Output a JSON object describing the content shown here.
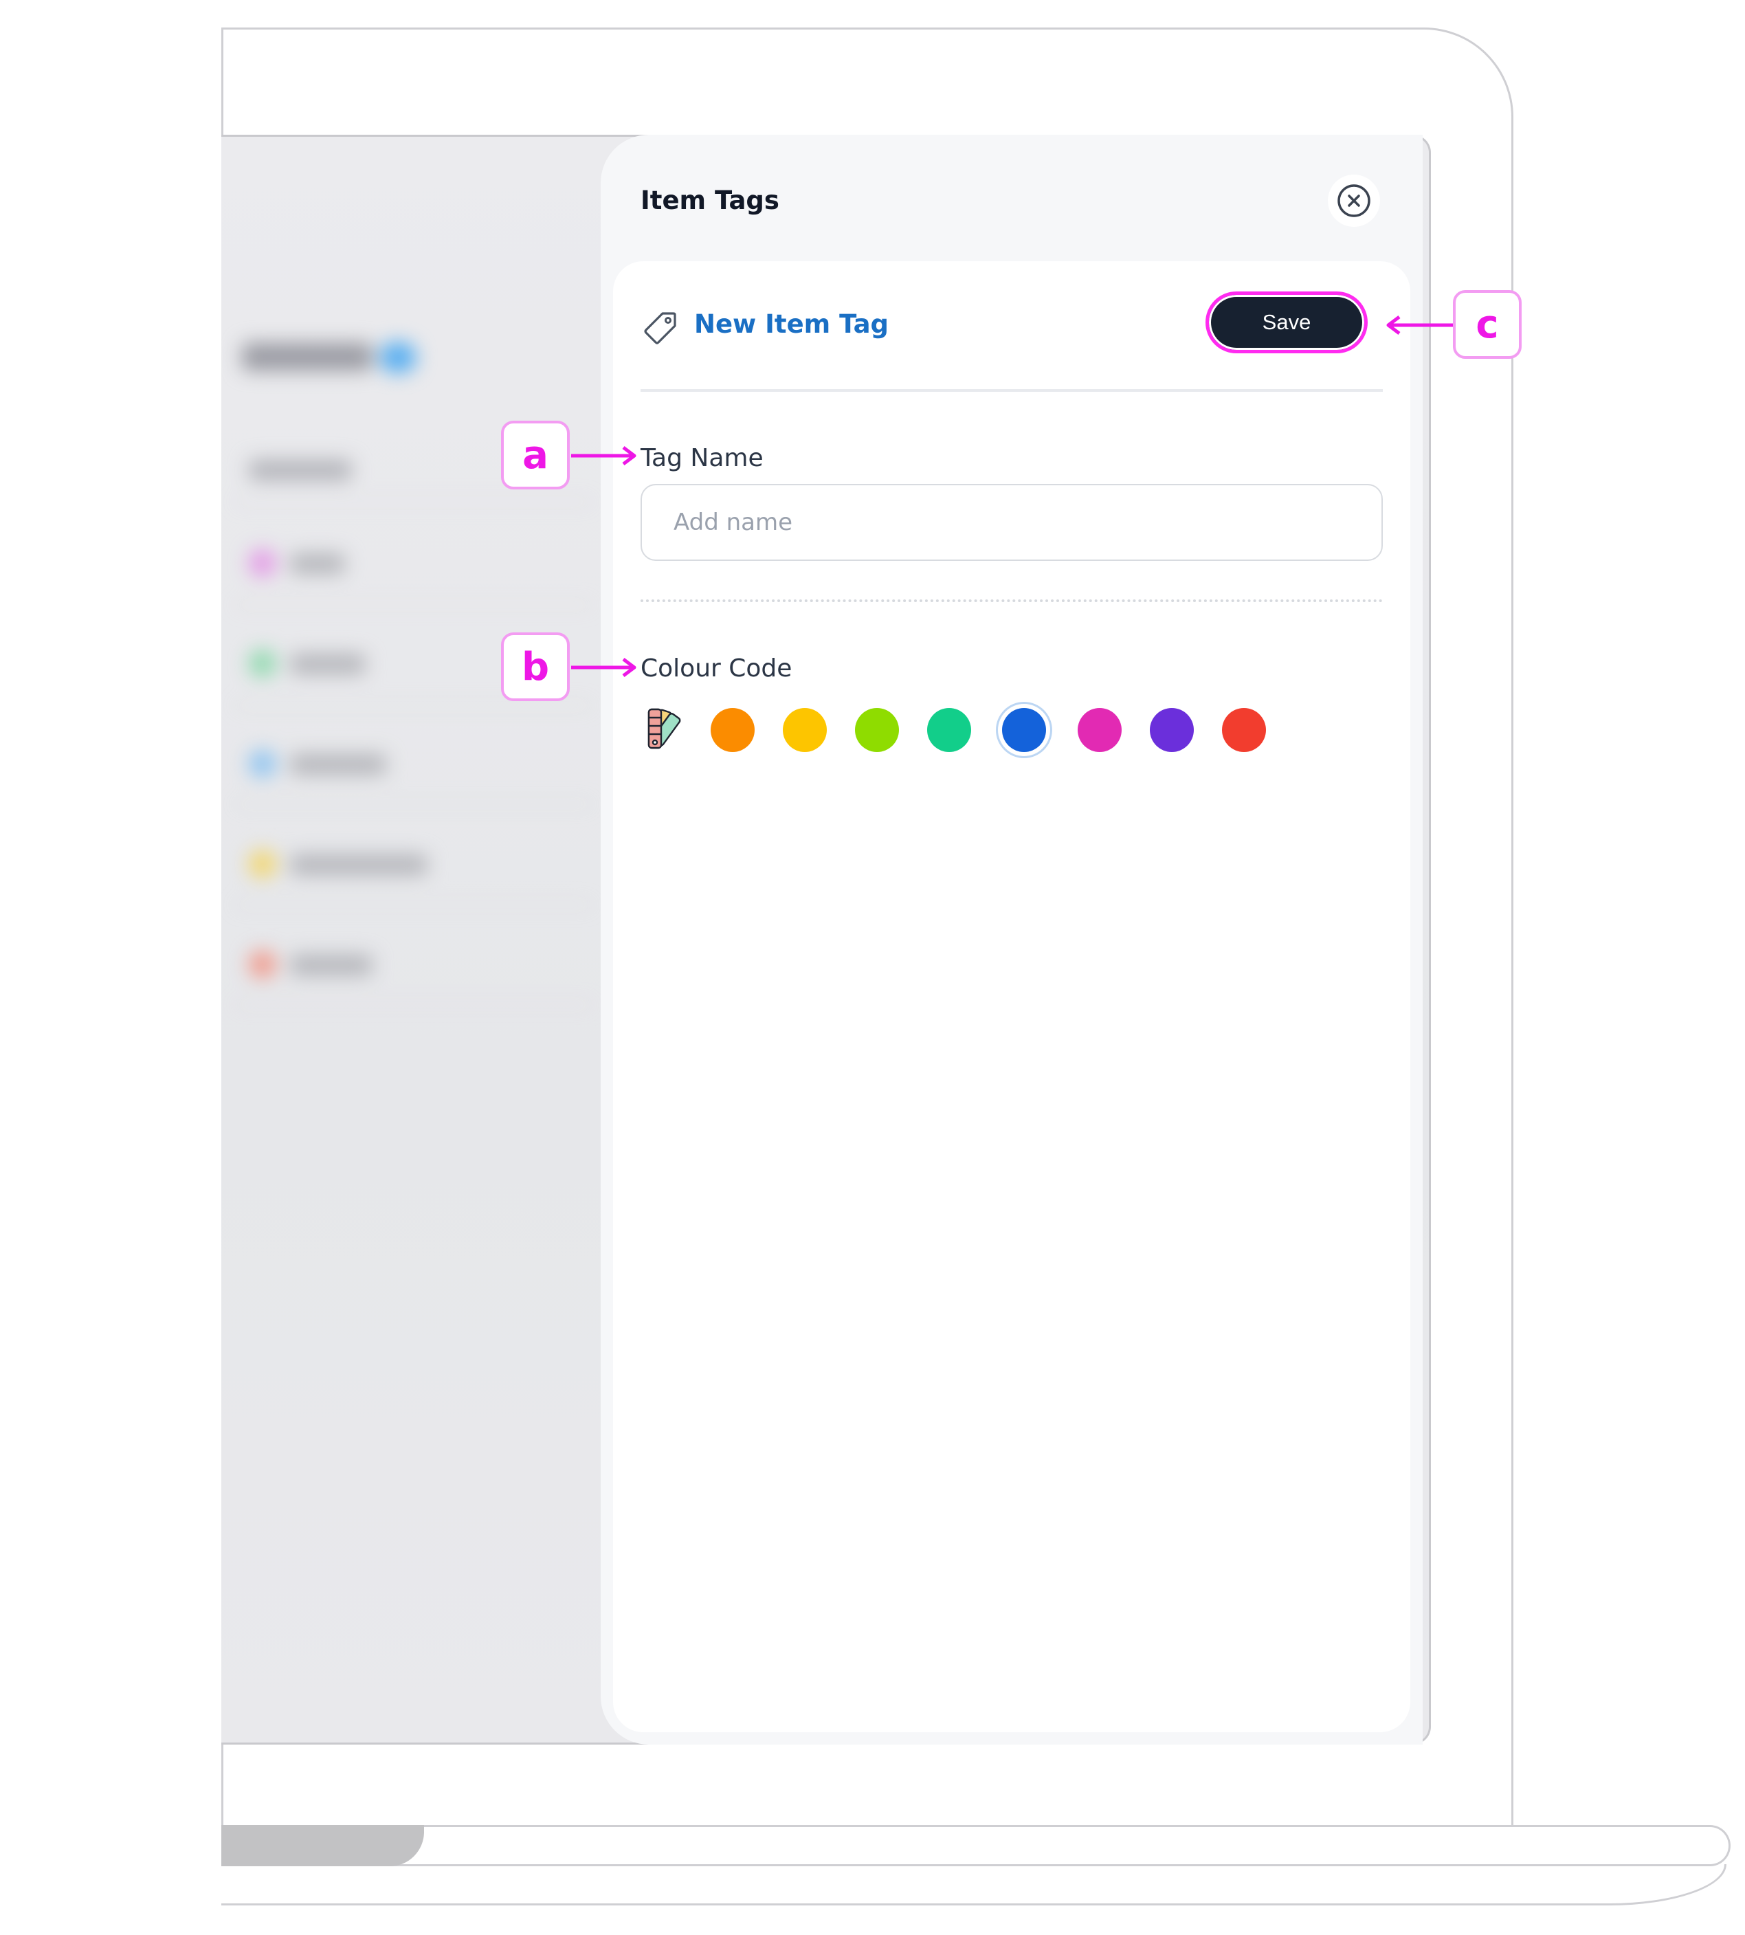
{
  "panel": {
    "title": "Item Tags",
    "close_icon": "close-circle-icon"
  },
  "form": {
    "header_icon": "tag-icon",
    "header_title": "New Item Tag",
    "save_label": "Save",
    "tag_name_label": "Tag Name",
    "tag_name_placeholder": "Add name",
    "tag_name_value": "",
    "colour_label": "Colour Code",
    "palette_icon": "color-palette-icon",
    "colours": [
      {
        "name": "orange",
        "hex": "#FB8C00",
        "selected": false
      },
      {
        "name": "amber",
        "hex": "#FDC500",
        "selected": false
      },
      {
        "name": "lime",
        "hex": "#8FDC00",
        "selected": false
      },
      {
        "name": "green",
        "hex": "#12CE8A",
        "selected": false
      },
      {
        "name": "blue",
        "hex": "#1462DA",
        "selected": true
      },
      {
        "name": "magenta",
        "hex": "#E22AB3",
        "selected": false
      },
      {
        "name": "purple",
        "hex": "#6B2FDB",
        "selected": false
      },
      {
        "name": "red",
        "hex": "#F23D2E",
        "selected": false
      }
    ]
  },
  "annotations": {
    "a": "a",
    "b": "b",
    "c": "c",
    "accent": "#EE17E6"
  }
}
